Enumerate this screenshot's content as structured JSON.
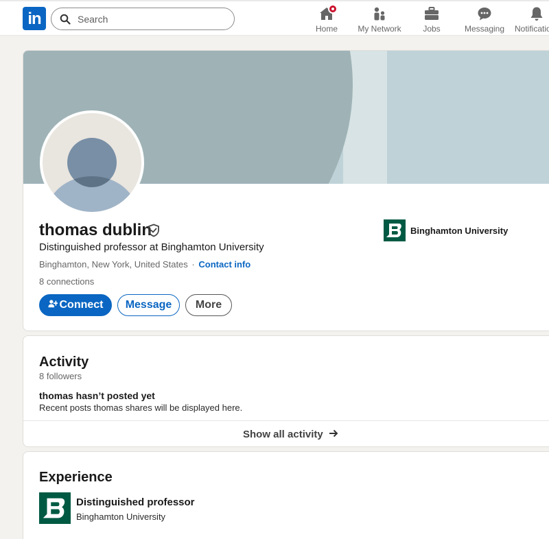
{
  "brand": {
    "logo_text": "in",
    "color": "#0a66c2"
  },
  "search": {
    "placeholder": "Search",
    "value": ""
  },
  "nav": {
    "items": [
      {
        "label": "Home",
        "icon": "home-icon",
        "has_badge": true
      },
      {
        "label": "My Network",
        "icon": "network-icon"
      },
      {
        "label": "Jobs",
        "icon": "briefcase-icon"
      },
      {
        "label": "Messaging",
        "icon": "message-icon"
      },
      {
        "label": "Notifications",
        "icon": "bell-icon"
      }
    ]
  },
  "profile": {
    "name": "thomas dublin",
    "headline": "Distinguished professor at Binghamton University",
    "location": "Binghamton, New York, United States",
    "location_separator": "·",
    "contact_label": "Contact info",
    "connections_count": "8",
    "connections_label": "connections",
    "organization": "Binghamton University",
    "buttons": {
      "connect": "Connect",
      "message": "Message",
      "more": "More"
    }
  },
  "activity": {
    "title": "Activity",
    "followers": "8 followers",
    "empty_title": "thomas hasn’t posted yet",
    "empty_subtitle": "Recent posts thomas shares will be displayed here.",
    "show_all": "Show all activity"
  },
  "experience": {
    "title": "Experience",
    "items": [
      {
        "role": "Distinguished professor",
        "organization": "Binghamton University"
      }
    ]
  },
  "colors": {
    "accent": "#0a66c2",
    "badge": "#cb112d",
    "org_logo": "#005a43",
    "page_bg": "#f4f2ee"
  }
}
